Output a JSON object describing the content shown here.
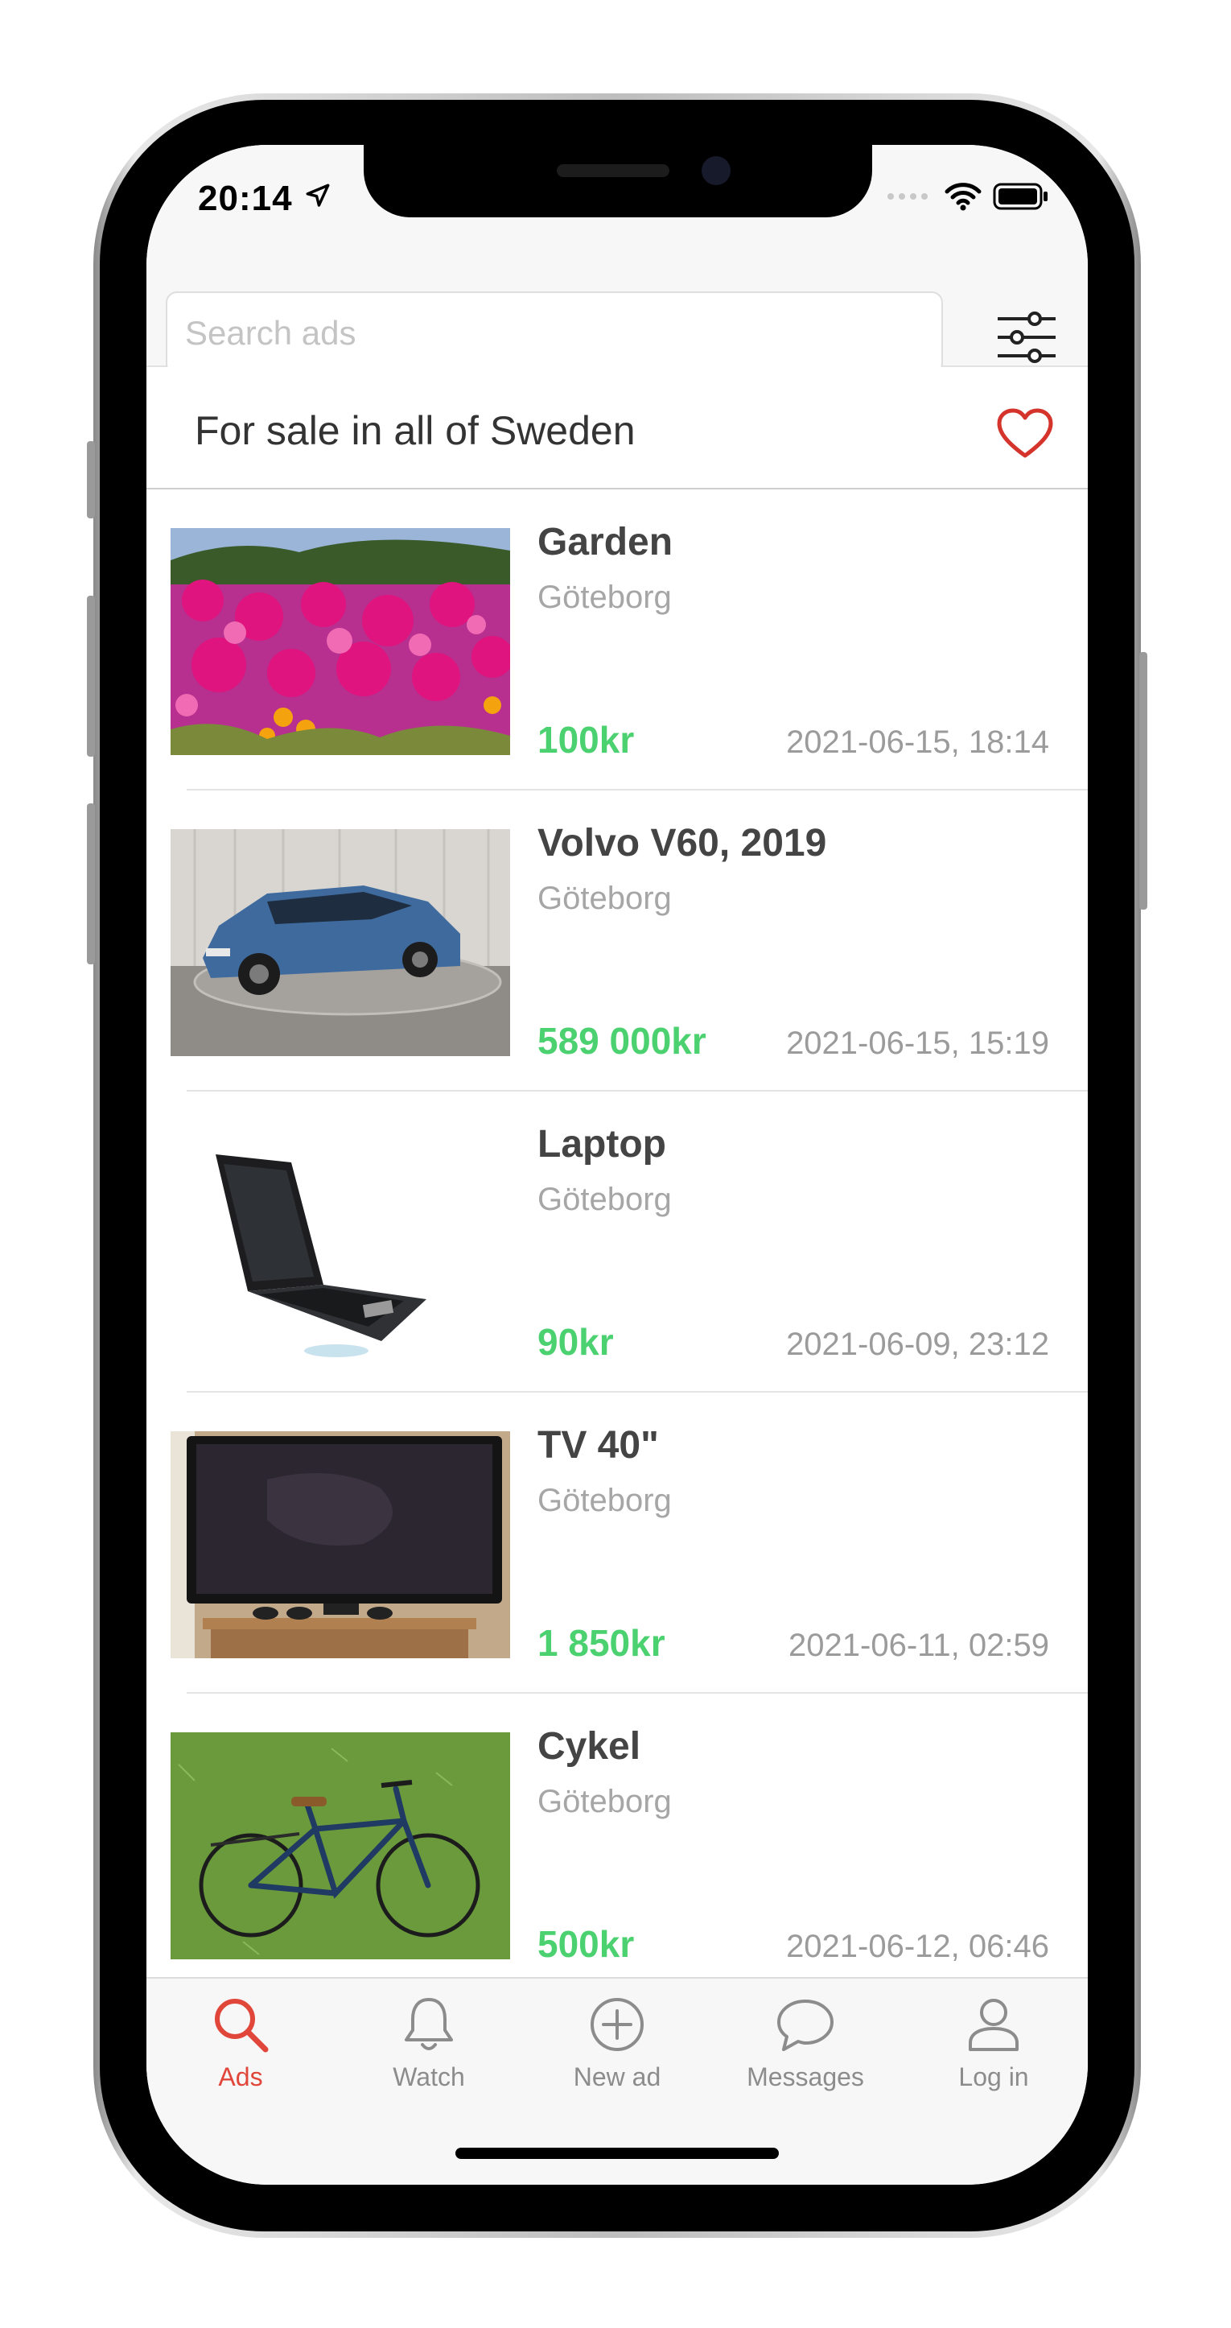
{
  "status_bar": {
    "time": "20:14"
  },
  "search": {
    "placeholder": "Search ads"
  },
  "section": {
    "title": "For sale in all of Sweden"
  },
  "ads": [
    {
      "title": "Garden",
      "city": "Göteborg",
      "price": "100kr",
      "date": "2021-06-15, 18:14"
    },
    {
      "title": "Volvo V60, 2019",
      "city": "Göteborg",
      "price": "589 000kr",
      "date": "2021-06-15, 15:19"
    },
    {
      "title": "Laptop",
      "city": "Göteborg",
      "price": "90kr",
      "date": "2021-06-09, 23:12"
    },
    {
      "title": "TV 40\"",
      "city": "Göteborg",
      "price": "1 850kr",
      "date": "2021-06-11, 02:59"
    },
    {
      "title": "Cykel",
      "city": "Göteborg",
      "price": "500kr",
      "date": "2021-06-12, 06:46"
    }
  ],
  "tabs": [
    {
      "label": "Ads",
      "icon": "search-icon",
      "active": true
    },
    {
      "label": "Watch",
      "icon": "bell-icon",
      "active": false
    },
    {
      "label": "New ad",
      "icon": "plus-circle-icon",
      "active": false
    },
    {
      "label": "Messages",
      "icon": "chat-bubble-icon",
      "active": false
    },
    {
      "label": "Log in",
      "icon": "user-icon",
      "active": false
    }
  ],
  "colors": {
    "accent": "#e0463a",
    "price": "#4cd171",
    "muted_text": "#a6a6a6",
    "header_bg": "#f7f7f7"
  }
}
